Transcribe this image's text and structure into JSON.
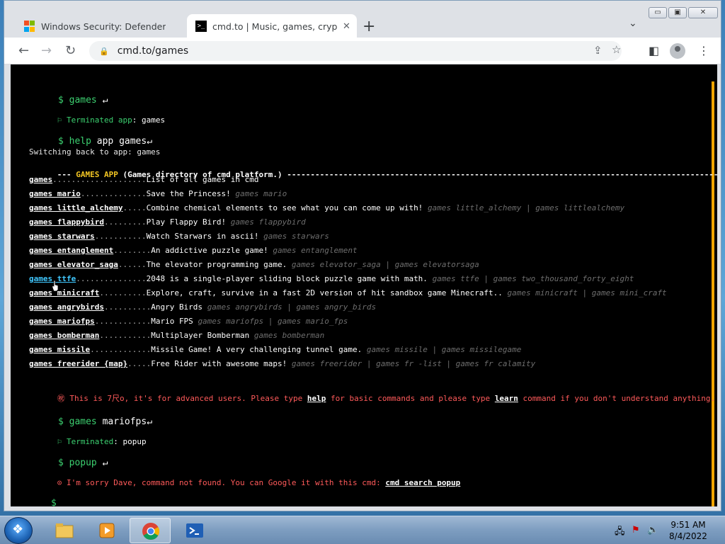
{
  "browser": {
    "tabs": [
      {
        "title": "Windows Security: Defender, Ant",
        "close": "✕"
      },
      {
        "title": "cmd.to | Music, games, cryptocur",
        "close": "✕"
      }
    ],
    "new_tab": "+",
    "tab_menu": "⌄",
    "window_controls": {
      "minimize": "▭",
      "maximize": "▣",
      "close": "✕"
    },
    "url": "cmd.to/games",
    "nav": {
      "back": "←",
      "forward": "→",
      "reload": "↻"
    }
  },
  "terminal": {
    "cmd1": {
      "prompt": "$",
      "text": "games",
      "enter": "↵"
    },
    "terminated1": {
      "label": "Terminated app",
      "value": ": games"
    },
    "cmd2": {
      "prompt": "$",
      "text1": "help",
      "text2": "app games",
      "enter": "↵"
    },
    "switching": "Switching back to app: games",
    "header": {
      "prefix": "--- ",
      "title": "GAMES APP",
      "desc": " (Games directory of cmd platform.) ",
      "dashes": "-------------------------------------------------------------------------------------------------"
    },
    "games": [
      {
        "name": "games",
        "dots": "....................",
        "desc": "List of all games in cmd",
        "alias": ""
      },
      {
        "name": "games mario",
        "dots": "..............",
        "desc": "Save the Princess! ",
        "alias": "games mario"
      },
      {
        "name": "games little_alchemy",
        "dots": ".....",
        "desc": "Combine chemical elements to see what you can come up with! ",
        "alias": "games little_alchemy | games littlealchemy"
      },
      {
        "name": "games flappybird",
        "dots": ".........",
        "desc": "Play Flappy Bird! ",
        "alias": "games flappybird"
      },
      {
        "name": "games starwars",
        "dots": "...........",
        "desc": "Watch Starwars in ascii! ",
        "alias": "games starwars"
      },
      {
        "name": "games entanglement",
        "dots": "........",
        "desc": "An addictive puzzle game! ",
        "alias": "games entanglement"
      },
      {
        "name": "games elevator_saga",
        "dots": "......",
        "desc": "The elevator programming game. ",
        "alias": "games elevator_saga | games elevatorsaga"
      },
      {
        "name": "games ttfe",
        "dots": "...............",
        "desc": "2048 is a single-player sliding block puzzle game with math. ",
        "alias": "games ttfe | games two_thousand_forty_eight"
      },
      {
        "name": "games minicraft",
        "dots": "..........",
        "desc": "Explore, craft, survive in a fast 2D version of hit sandbox game Minecraft.. ",
        "alias": "games minicraft | games mini_craft"
      },
      {
        "name": "games angrybirds",
        "dots": "..........",
        "desc": "Angry Birds ",
        "alias": "games angrybirds | games angry_birds"
      },
      {
        "name": "games mariofps",
        "dots": "............",
        "desc": "Mario FPS ",
        "alias": "games mariofps | games mario_fps"
      },
      {
        "name": "games bomberman",
        "dots": "...........",
        "desc": "Multiplayer Bomberman ",
        "alias": "games bomberman"
      },
      {
        "name": "games missile",
        "dots": ".............",
        "desc": "Missile Game! A very challenging tunnel game. ",
        "alias": "games missile | games missilegame"
      },
      {
        "name": "games freerider {map}",
        "dots": ".....",
        "desc": "Free Rider with awesome maps! ",
        "alias": "games freerider | games fr -list | games fr calamity"
      }
    ],
    "warning": {
      "icon": "㊗",
      "t1": " This is 7尺o, it's for advanced users. Please type ",
      "help": "help",
      "t2": " for basic commands and please type ",
      "learn": "learn",
      "t3": " command if you don't understand anything."
    },
    "cmd3": {
      "prompt": "$",
      "text1": "games",
      "text2": "mariofps",
      "enter": "↵"
    },
    "terminated2": {
      "label": "Terminated",
      "value": ": popup"
    },
    "cmd4": {
      "prompt": "$",
      "text": "popup",
      "enter": "↵"
    },
    "error": {
      "icon": "⊙",
      "text": " I'm sorry Dave, command not found. You can Google it with this cmd: ",
      "cmd": "cmd search popup"
    },
    "cmd5": {
      "prompt": "$"
    }
  },
  "taskbar": {
    "time": "9:51 AM",
    "date": "8/4/2022"
  }
}
